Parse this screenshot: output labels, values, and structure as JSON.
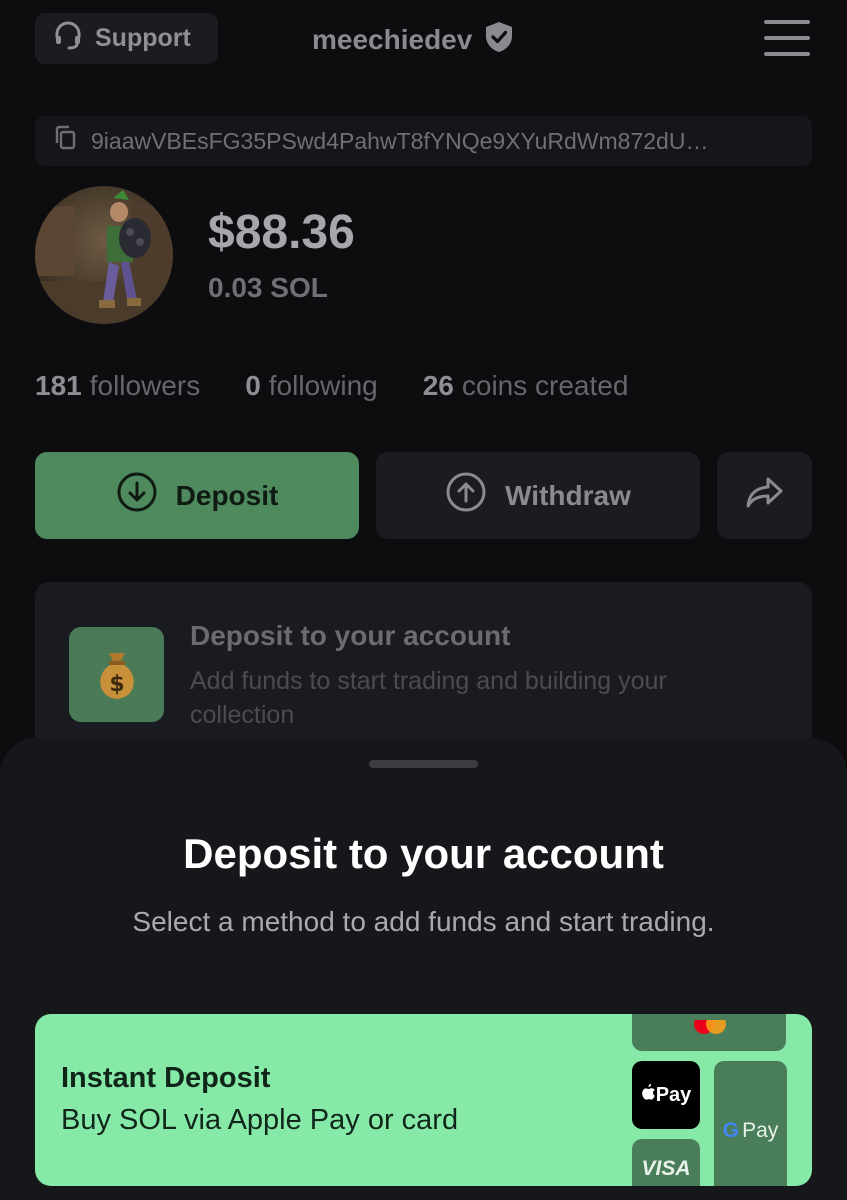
{
  "header": {
    "support_label": "Support",
    "username": "meechiedev",
    "verified_icon": "shield-check-icon",
    "menu_icon": "hamburger-menu-icon"
  },
  "wallet": {
    "address": "9iaawVBEsFG35PSwd4PahwT8fYNQe9XYuRdWm872dU…",
    "copy_icon": "copy-icon"
  },
  "profile": {
    "balance_usd": "$88.36",
    "balance_sol": "0.03 SOL"
  },
  "stats": {
    "followers_count": "181",
    "followers_label": "followers",
    "following_count": "0",
    "following_label": "following",
    "coins_count": "26",
    "coins_label": "coins created"
  },
  "actions": {
    "deposit_label": "Deposit",
    "withdraw_label": "Withdraw",
    "share_icon": "share-arrow-icon"
  },
  "deposit_card": {
    "title": "Deposit to your account",
    "subtitle": "Add funds to start trading and building your collection",
    "icon": "money-bag-icon"
  },
  "sheet": {
    "title": "Deposit to your account",
    "subtitle": "Select a method to add funds and start trading.",
    "instant": {
      "title": "Instant Deposit",
      "subtitle": "Buy SOL via Apple Pay or card",
      "apple_pay": "Pay",
      "google_pay": "Pay",
      "visa": "VISA"
    }
  },
  "colors": {
    "background": "#0d0d0f",
    "deposit_button": "#4f8a5e",
    "instant_card": "#86e9a8",
    "sheet": "#16171b"
  }
}
